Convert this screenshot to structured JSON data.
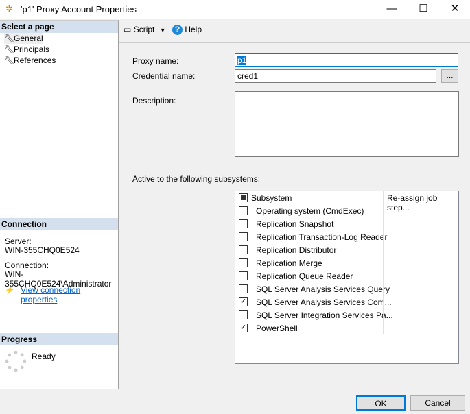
{
  "window": {
    "title": "'p1' Proxy Account Properties",
    "minimize": "—",
    "maximize": "☐",
    "close": "✕"
  },
  "sidebar": {
    "select_header": "Select a page",
    "pages": [
      {
        "label": "General"
      },
      {
        "label": "Principals"
      },
      {
        "label": "References"
      }
    ],
    "connection_header": "Connection",
    "server_label": "Server:",
    "server": "WIN-355CHQ0E524",
    "connection_label": "Connection:",
    "connection": "WIN-355CHQ0E524\\Administrator",
    "view_link": "View connection properties",
    "progress_header": "Progress",
    "progress_status": "Ready"
  },
  "toolbar": {
    "script": "Script",
    "help": "Help"
  },
  "form": {
    "proxy_name_label": "Proxy name:",
    "proxy_name": "p1",
    "credential_label": "Credential name:",
    "credential": "cred1",
    "browse": "...",
    "description_label": "Description:",
    "description": "",
    "subsystems_label": "Active to the following subsystems:"
  },
  "grid": {
    "headers": [
      "Subsystem",
      "Re-assign job step..."
    ],
    "rows": [
      {
        "name": "Operating system (CmdExec)",
        "checked": false
      },
      {
        "name": "Replication Snapshot",
        "checked": false
      },
      {
        "name": "Replication Transaction-Log Reader",
        "checked": false
      },
      {
        "name": "Replication Distributor",
        "checked": false
      },
      {
        "name": "Replication Merge",
        "checked": false
      },
      {
        "name": "Replication Queue Reader",
        "checked": false
      },
      {
        "name": "SQL Server Analysis Services Query",
        "checked": false
      },
      {
        "name": "SQL Server Analysis Services Com...",
        "checked": true
      },
      {
        "name": "SQL Server Integration Services Pa...",
        "checked": false
      },
      {
        "name": "PowerShell",
        "checked": true
      }
    ]
  },
  "buttons": {
    "ok": "OK",
    "cancel": "Cancel"
  }
}
